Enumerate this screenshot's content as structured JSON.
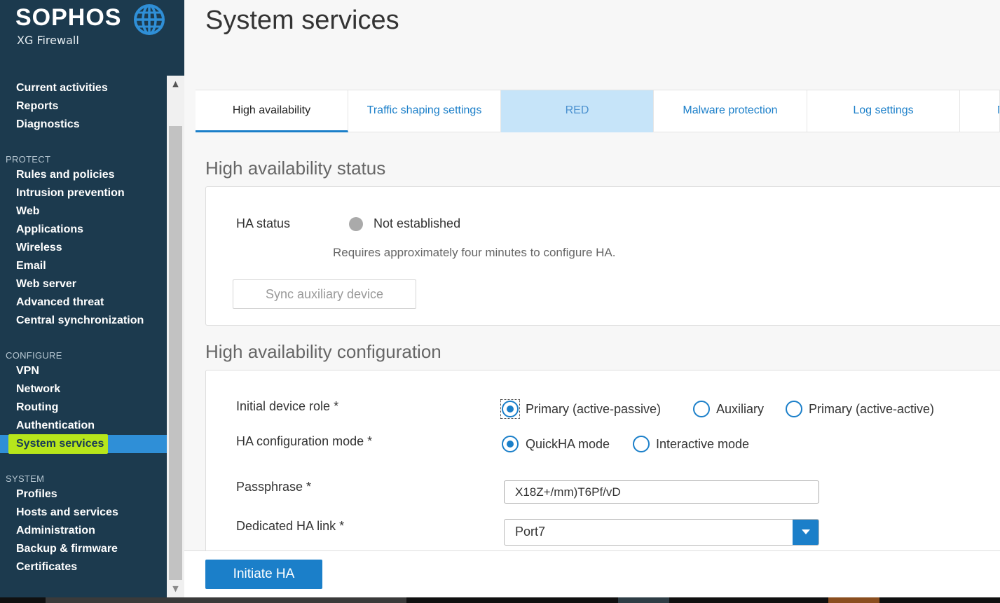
{
  "brand": {
    "name": "SOPHOS",
    "product": "XG Firewall"
  },
  "nav": {
    "top_items": [
      "Current activities",
      "Reports",
      "Diagnostics"
    ],
    "protect_label": "PROTECT",
    "protect_items": [
      "Rules and policies",
      "Intrusion prevention",
      "Web",
      "Applications",
      "Wireless",
      "Email",
      "Web server",
      "Advanced threat",
      "Central synchronization"
    ],
    "configure_label": "CONFIGURE",
    "configure_items": [
      "VPN",
      "Network",
      "Routing",
      "Authentication",
      "System services"
    ],
    "system_label": "SYSTEM",
    "system_items": [
      "Profiles",
      "Hosts and services",
      "Administration",
      "Backup & firmware",
      "Certificates"
    ],
    "active_item": "System services"
  },
  "page": {
    "title": "System services"
  },
  "tabs": [
    {
      "label": "High availability",
      "state": "active"
    },
    {
      "label": "Traffic shaping settings",
      "state": "normal"
    },
    {
      "label": "RED",
      "state": "hovered"
    },
    {
      "label": "Malware protection",
      "state": "normal"
    },
    {
      "label": "Log settings",
      "state": "normal"
    },
    {
      "label": "N",
      "state": "normal"
    }
  ],
  "status_section": {
    "title": "High availability status",
    "ha_status_label": "HA status",
    "ha_status_value": "Not established",
    "hint": "Requires approximately four minutes to configure HA.",
    "sync_button": "Sync auxiliary device"
  },
  "config_section": {
    "title": "High availability configuration",
    "device_role_label": "Initial device role *",
    "device_role_options": [
      "Primary (active-passive)",
      "Auxiliary",
      "Primary (active-active)"
    ],
    "device_role_selected": "Primary (active-passive)",
    "config_mode_label": "HA configuration mode *",
    "config_mode_options": [
      "QuickHA mode",
      "Interactive mode"
    ],
    "config_mode_selected": "QuickHA mode",
    "passphrase_label": "Passphrase *",
    "passphrase_value": "X18Z+/mm)T6Pf/vD",
    "ha_link_label": "Dedicated HA link *",
    "ha_link_value": "Port7"
  },
  "footer": {
    "initiate_button": "Initiate HA"
  },
  "colors": {
    "sidebar_bg": "#1c3a4e",
    "accent": "#1b7fc9",
    "active_nav": "#2f8fd7",
    "highlight": "#b7e61b",
    "status_dot": "#aaaaaa"
  }
}
